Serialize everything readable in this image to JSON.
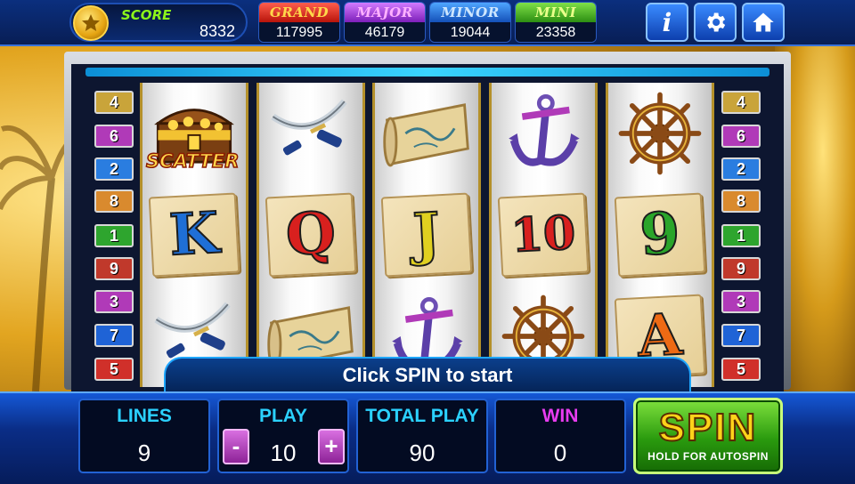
{
  "header": {
    "score_label": "SCORE",
    "score_value": "8332",
    "jackpots": [
      {
        "label": "GRAND",
        "value": "117995"
      },
      {
        "label": "MAJOR",
        "value": "46179"
      },
      {
        "label": "MINOR",
        "value": "19044"
      },
      {
        "label": "MINI",
        "value": "23358"
      }
    ],
    "buttons": {
      "info": "i"
    }
  },
  "paylines": {
    "left": [
      "4",
      "6",
      "2",
      "8",
      "1",
      "9",
      "3",
      "7",
      "5"
    ],
    "right": [
      "4",
      "6",
      "2",
      "8",
      "1",
      "9",
      "3",
      "7",
      "5"
    ],
    "colors": [
      "#c9a43a",
      "#b03ab8",
      "#2a7de0",
      "#d98a2e",
      "#2ea52e",
      "#c0392b",
      "#b03ab8",
      "#1f63d6",
      "#d0302a"
    ]
  },
  "reels": [
    [
      "treasure-chest",
      "K",
      "swords"
    ],
    [
      "swords",
      "Q",
      "map"
    ],
    [
      "map",
      "J",
      "anchor"
    ],
    [
      "anchor",
      "10",
      "ship-wheel"
    ],
    [
      "ship-wheel",
      "9",
      "A"
    ]
  ],
  "scatter_text": "SCATTER",
  "message": "Click SPIN to start",
  "stats": {
    "lines_label": "LINES",
    "lines_value": "9",
    "play_label": "PLAY",
    "play_value": "10",
    "total_label": "TOTAL PLAY",
    "total_value": "90",
    "win_label": "WIN",
    "win_value": "0",
    "minus": "-",
    "plus": "+"
  },
  "spin": {
    "label": "SPIN",
    "sub": "HOLD FOR AUTOSPIN"
  },
  "letter_colors": {
    "K": "#1f6fd6",
    "Q": "#d8201e",
    "J": "#e0d020",
    "10": "#d8201e",
    "9": "#2aa52a",
    "A": "#ee6a14"
  }
}
